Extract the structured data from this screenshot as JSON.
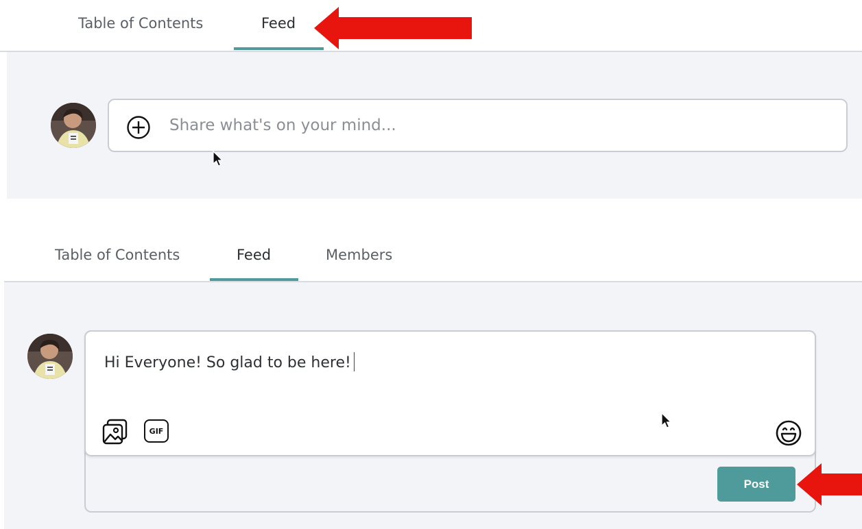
{
  "top": {
    "tabs": [
      {
        "label": "Table of Contents"
      },
      {
        "label": "Feed",
        "active": true
      }
    ],
    "composer": {
      "placeholder": "Share what's on your mind..."
    }
  },
  "bottom": {
    "tabs": [
      {
        "label": "Table of Contents"
      },
      {
        "label": "Feed",
        "active": true
      },
      {
        "label": "Members"
      }
    ],
    "composer": {
      "text": "Hi Everyone! So glad to be here!",
      "gif_label": "GIF",
      "post_label": "Post"
    }
  },
  "colors": {
    "accent": "#4f9a9b",
    "annotation_arrow": "#e8150f",
    "panel_background": "#f3f4f8"
  },
  "icons": {
    "add": "plus-circle-icon",
    "image": "image-icon",
    "gif": "gif-icon",
    "emoji": "emoji-icon"
  }
}
